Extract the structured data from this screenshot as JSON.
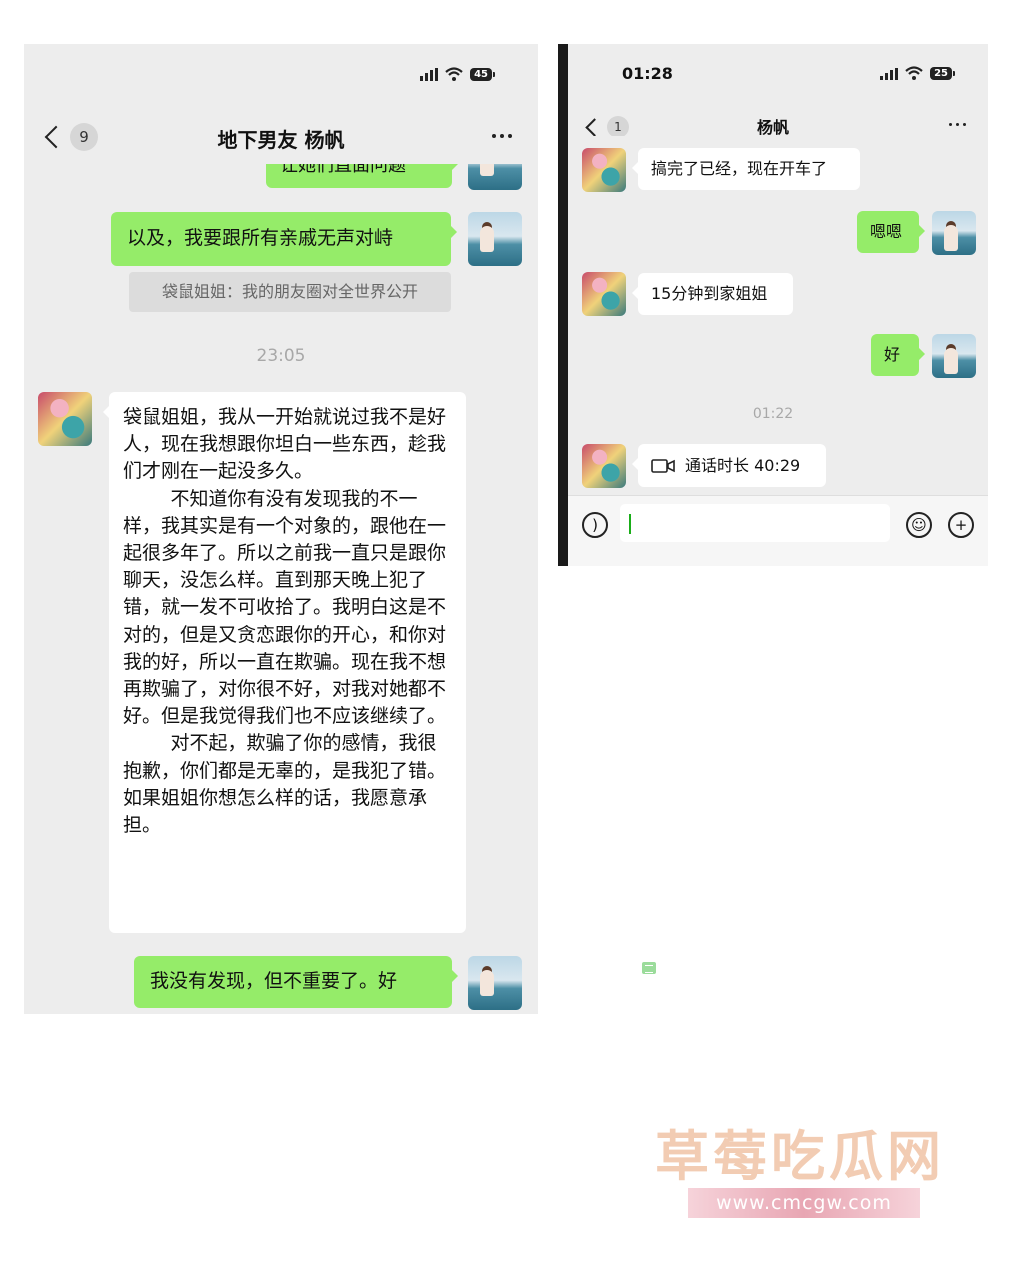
{
  "left": {
    "status": {
      "battery": "45"
    },
    "nav": {
      "back_count": "9",
      "title": "地下男友 杨帆"
    },
    "messages": [
      {
        "type": "out",
        "text": "让她们直面问题"
      },
      {
        "type": "out",
        "text": "以及，我要跟所有亲戚无声对峙"
      },
      {
        "type": "system",
        "text": "袋鼠姐姐：我的朋友圈对全世界公开"
      },
      {
        "type": "timestamp",
        "text": "23:05"
      },
      {
        "type": "in",
        "paragraphs": [
          "袋鼠姐姐，我从一开始就说过我不是好人，现在我想跟你坦白一些东西，趁我们才刚在一起没多久。",
          "不知道你有没有发现我的不一样，我其实是有一个对象的，跟他在一起很多年了。所以之前我一直只是跟你聊天，没怎么样。直到那天晚上犯了错，就一发不可收拾了。我明白这是不对的，但是又贪恋跟你的开心，和你对我的好，所以一直在欺骗。现在我不想再欺骗了，对你很不好，对我对她都不好。但是我觉得我们也不应该继续了。",
          "对不起，欺骗了你的感情，我很抱歉，你们都是无辜的，是我犯了错。如果姐姐你想怎么样的话，我愿意承担。"
        ]
      },
      {
        "type": "out",
        "text": "我没有发现，但不重要了。好"
      }
    ]
  },
  "right": {
    "status": {
      "time": "01:28",
      "battery": "25"
    },
    "nav": {
      "back_count": "1",
      "title": "杨帆"
    },
    "messages": [
      {
        "type": "in",
        "text": "搞完了已经，现在开车了"
      },
      {
        "type": "out",
        "text": "嗯嗯"
      },
      {
        "type": "in",
        "text": "15分钟到家姐姐"
      },
      {
        "type": "out",
        "text": "好"
      },
      {
        "type": "timestamp",
        "text": "01:22"
      },
      {
        "type": "call",
        "text": "通话时长 40:29"
      }
    ]
  },
  "watermark": {
    "logo": "草莓吃瓜网",
    "url": "www.cmcgw.com"
  },
  "icons": [
    "signal-icon",
    "wifi-icon",
    "battery-icon",
    "back-chevron-icon",
    "more-icon",
    "video-call-icon",
    "voice-icon",
    "emoji-icon",
    "plus-icon",
    "doc-icon"
  ],
  "colors": {
    "outgoing_bubble": "#95ec69",
    "chat_bg": "#ededed",
    "incoming_bubble": "#ffffff",
    "watermark": "#f0c4a6"
  }
}
